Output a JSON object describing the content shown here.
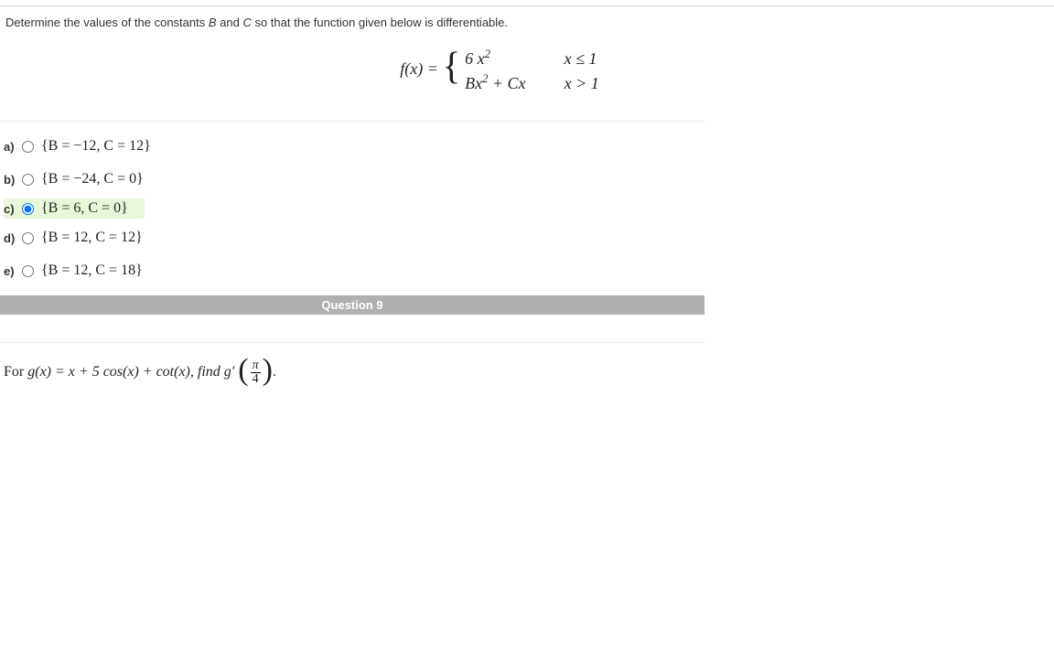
{
  "q8": {
    "prompt_start": "Determine the values of the constants ",
    "constB": "B",
    "and": " and ",
    "constC": "C",
    "prompt_end": " so that the function given below is differentiable.",
    "fx_label": "f(x) = ",
    "case1_expr": "6 x",
    "case1_cond": "x ≤ 1",
    "case2_expr_B": "Bx",
    "case2_expr_plus": " + Cx",
    "case2_cond": "x > 1",
    "options": {
      "a": {
        "letter": "a)",
        "text": "{B = −12, C = 12}"
      },
      "b": {
        "letter": "b)",
        "text": "{B = −24, C = 0}"
      },
      "c": {
        "letter": "c)",
        "text": "{B = 6, C = 0}"
      },
      "d": {
        "letter": "d)",
        "text": "{B = 12, C = 12}"
      },
      "e": {
        "letter": "e)",
        "text": "{B = 12, C = 18}"
      }
    }
  },
  "q9": {
    "header": "Question 9",
    "prompt_for": "For  ",
    "g_def": "g(x) = x + 5 cos(x) + cot(x),  find  g′",
    "frac_num": "π",
    "frac_den": "4",
    "period": "."
  }
}
